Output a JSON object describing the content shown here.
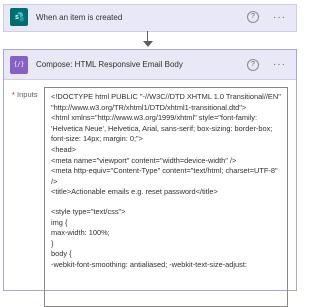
{
  "trigger": {
    "title": "When an item is created",
    "icon": "sharepoint-icon",
    "icon_color": "#036c70",
    "help_glyph": "?",
    "more_glyph": "···"
  },
  "compose": {
    "title": "Compose: HTML Responsive Email Body",
    "icon": "compose-icon",
    "icon_color": "#8661c5",
    "icon_glyph": "{/}",
    "help_glyph": "?",
    "more_glyph": "···",
    "inputs_label": "Inputs",
    "required_mark": "*",
    "input_lines": [
      "<!DOCTYPE html PUBLIC \"-//W3C//DTD XHTML 1.0 Transitional//EN\" \"http://www.w3.org/TR/xhtml1/DTD/xhtml1-transitional.dtd\">",
      "<html xmlns=\"http://www.w3.org/1999/xhtml\" style=\"font-family: 'Helvetica Neue', Helvetica, Arial, sans-serif; box-sizing: border-box; font-size: 14px; margin: 0;\">",
      "<head>",
      "<meta name=\"viewport\" content=\"width=device-width\" />",
      "<meta http-equiv=\"Content-Type\" content=\"text/html; charset=UTF-8\" />",
      "<title>Actionable emails e.g. reset password</title>",
      "",
      "<style type=\"text/css\">",
      "img {",
      "max-width: 100%;",
      "}",
      "body {",
      "-webkit-font-smoothing: antialiased; -webkit-text-size-adjust:"
    ]
  }
}
